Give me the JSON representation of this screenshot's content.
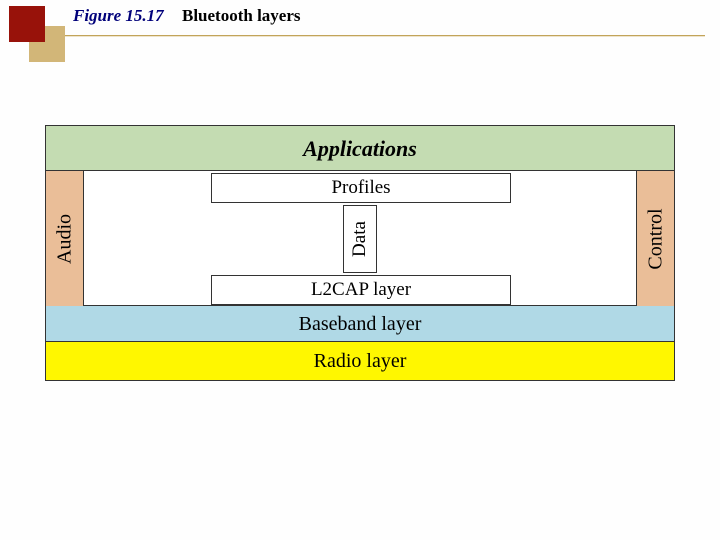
{
  "figure": {
    "number": "Figure 15.17",
    "title": "Bluetooth layers"
  },
  "layers": {
    "applications": "Applications",
    "profiles": "Profiles",
    "audio": "Audio",
    "data": "Data",
    "control": "Control",
    "l2cap": "L2CAP layer",
    "baseband": "Baseband layer",
    "radio": "Radio layer"
  }
}
